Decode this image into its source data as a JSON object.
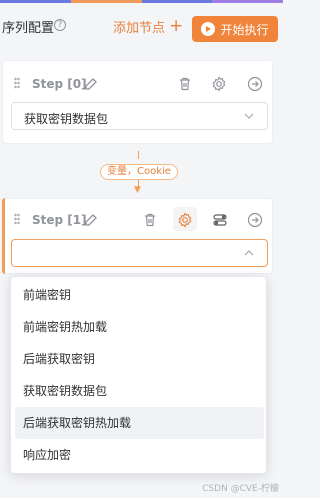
{
  "topbar_colors": [
    "#6b7be0",
    "#f29a5c",
    "#6b7be0",
    "#9f7ee6"
  ],
  "header": {
    "title": "序列配置",
    "help_icon": "?",
    "add_node_label": "添加节点",
    "add_icon": "+",
    "run_label": "开始执行"
  },
  "steps": [
    {
      "label": "Step [0]",
      "select_value": "获取密钥数据包"
    },
    {
      "label": "Step [1]",
      "select_value": ""
    }
  ],
  "connector": {
    "tag": "变量，Cookie"
  },
  "dropdown": {
    "options": [
      "前端密钥",
      "前端密钥热加载",
      "后端获取密钥",
      "获取密钥数据包",
      "后端获取密钥热加载",
      "响应加密"
    ],
    "hovered_index": 4
  },
  "watermark": "CSDN @CVE-柠檬",
  "colors": {
    "accent": "#f0843b",
    "accent_text": "#e6813d"
  }
}
